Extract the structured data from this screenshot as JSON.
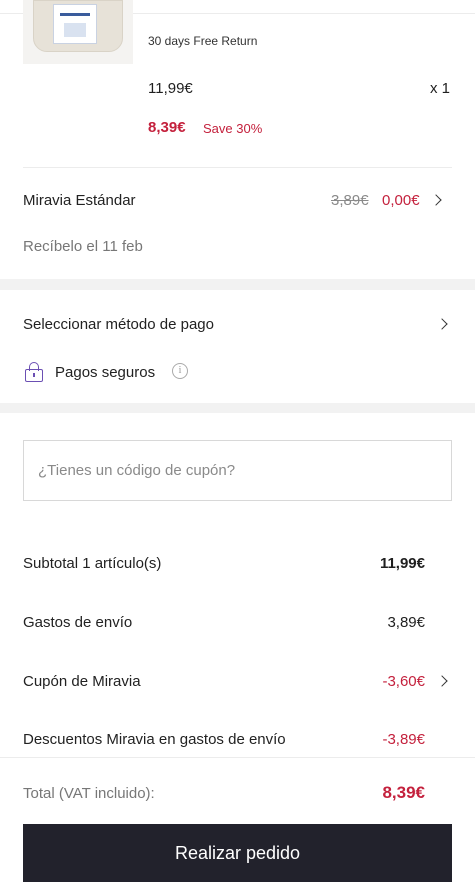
{
  "product": {
    "tag": "30 days Free Return",
    "price": "11,99€",
    "quantity": "x 1",
    "promo_price": "8,39€",
    "promo_save": "Save 30%"
  },
  "shipping": {
    "method": "Miravia Estándar",
    "old_price": "3,89€",
    "new_price": "0,00€",
    "delivery_estimate": "Recíbelo el 11 feb"
  },
  "payment": {
    "select_label": "Seleccionar método de pago",
    "secure_label": "Pagos seguros",
    "info_glyph": "i"
  },
  "coupon": {
    "placeholder": "¿Tienes un código de cupón?"
  },
  "summary": {
    "subtotal_label": "Subtotal 1 artículo(s)",
    "subtotal_value": "11,99€",
    "shipping_label": "Gastos de envío",
    "shipping_value": "3,89€",
    "coupon_label": "Cupón de Miravia",
    "coupon_value": "-3,60€",
    "shipping_discount_label": "Descuentos Miravia en gastos de envío",
    "shipping_discount_value": "-3,89€",
    "total_label": "Total (VAT incluido):",
    "total_value": "8,39€"
  },
  "cta": {
    "label": "Realizar pedido"
  },
  "colors": {
    "accent_red": "#c4213d",
    "button_dark": "#22222c",
    "lock_purple": "#6b4fb3"
  }
}
